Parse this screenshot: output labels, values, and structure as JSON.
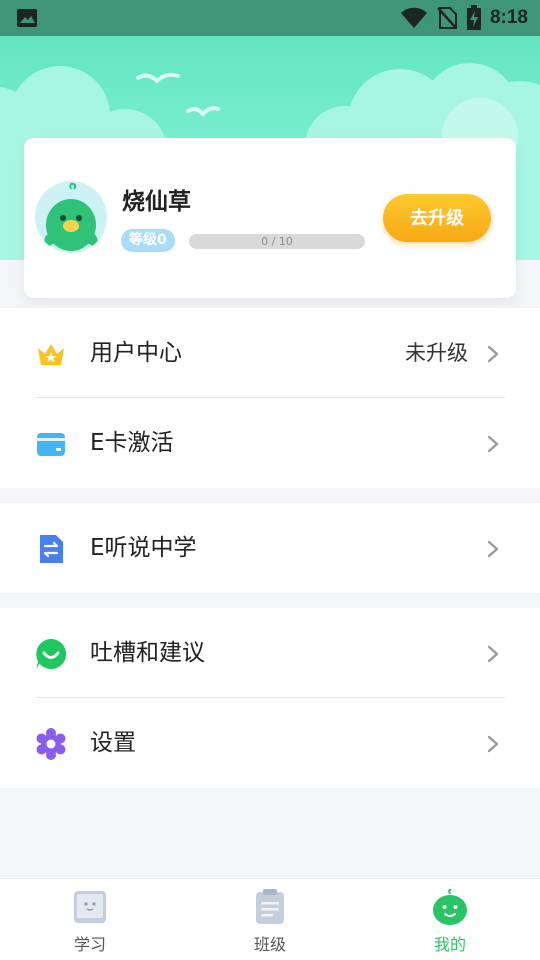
{
  "status_bar": {
    "time": "8:18",
    "icons": [
      "image-icon",
      "wifi-icon",
      "no-sim-icon",
      "battery-charging-icon"
    ]
  },
  "profile": {
    "username": "烧仙草",
    "level": "等级0",
    "progress_text": "0 / 10",
    "progress_fraction": 0,
    "upgrade_label": "去升级"
  },
  "menu": {
    "user_center": {
      "label": "用户中心",
      "value": "未升级",
      "icon": "crown-icon"
    },
    "e_card": {
      "label": "E卡激活",
      "icon": "card-icon"
    },
    "e_listen": {
      "label": "E听说中学",
      "icon": "exchange-icon"
    },
    "feedback": {
      "label": "吐槽和建议",
      "icon": "smile-chat-icon"
    },
    "settings": {
      "label": "设置",
      "icon": "gear-icon"
    }
  },
  "tabbar": {
    "tabs": [
      {
        "label": "学习",
        "icon": "book-icon",
        "active": false
      },
      {
        "label": "班级",
        "icon": "clipboard-icon",
        "active": false
      },
      {
        "label": "我的",
        "icon": "mascot-icon",
        "active": true
      }
    ]
  },
  "colors": {
    "hero": "#7ef0d4",
    "accent_green": "#29c564",
    "upgrade_button": "#f8a815",
    "level_badge": "#a8dcfb"
  }
}
